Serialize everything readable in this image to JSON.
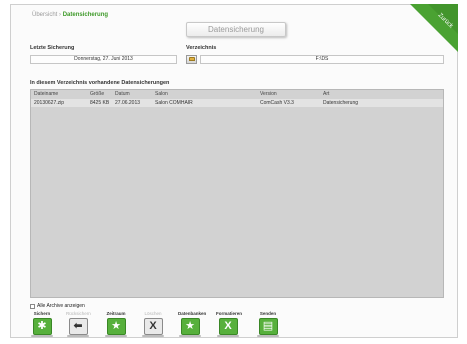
{
  "breadcrumb": {
    "parent": "Übersicht",
    "separator": "›",
    "current": "Datensicherung"
  },
  "title_button": "Datensicherung",
  "corner": {
    "label": "Zurück",
    "color": "#4aa232"
  },
  "last_backup": {
    "label": "Letzte Sicherung",
    "value": "Donnerstag, 27. Juni 2013"
  },
  "directory": {
    "label": "Verzeichnis",
    "value": "F:\\DS"
  },
  "list": {
    "title": "In diesem Verzeichnis vorhandene Datensicherungen",
    "columns": [
      "Dateiname",
      "Größe",
      "Datum",
      "Salon",
      "Version",
      "Art"
    ],
    "rows": [
      [
        "20130627.zip",
        "8425 KB",
        "27.06.2013",
        "Salon COMHAIR",
        "ComCash V3.3",
        "Datensicherung"
      ]
    ]
  },
  "show_all_archives": {
    "label": "Alle Archive anzeigen",
    "checked": false
  },
  "actions": [
    {
      "label": "Sichern",
      "icon": "asterisk-icon",
      "enabled": true
    },
    {
      "label": "Rücksichern",
      "icon": "arrow-left-icon",
      "enabled": false
    },
    {
      "label": "Zeitraum",
      "icon": "star-icon",
      "enabled": true
    },
    {
      "label": "Löschen",
      "icon": "x-icon",
      "enabled": false
    },
    {
      "label": "Datenbanken",
      "icon": "star-icon",
      "enabled": true
    },
    {
      "label": "Formatieren",
      "icon": "x-icon",
      "enabled": true
    },
    {
      "label": "Senden",
      "icon": "send-icon",
      "enabled": true
    }
  ],
  "colors": {
    "accent": "#4aa232",
    "list_background": "#d2d2d2"
  }
}
